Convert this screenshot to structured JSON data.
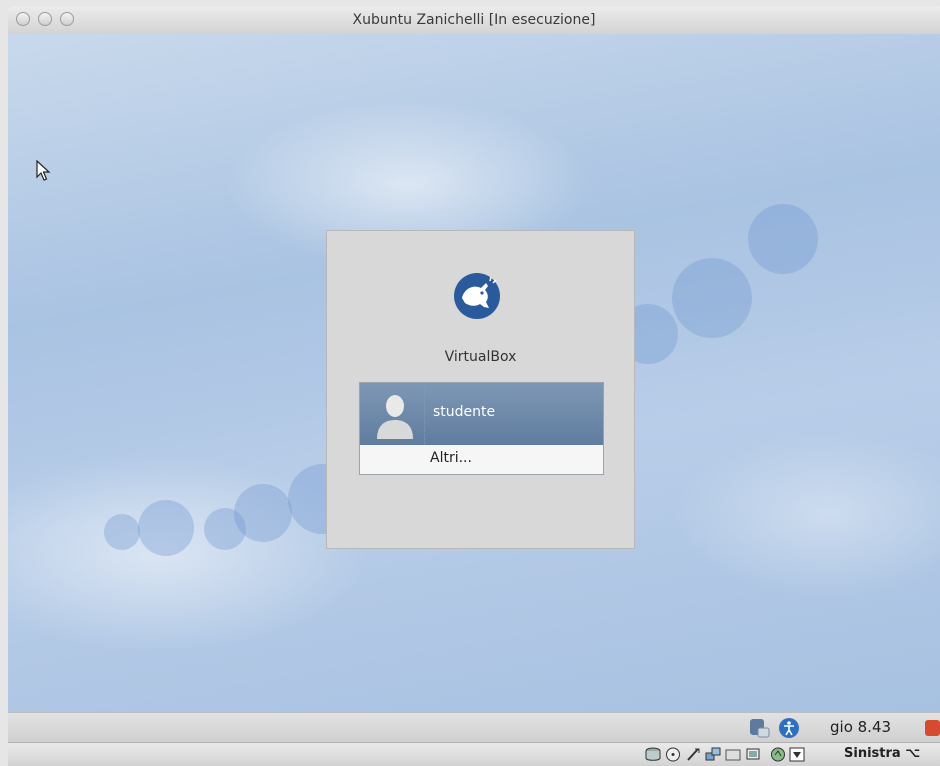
{
  "window": {
    "title": "Xubuntu Zanichelli [In esecuzione]"
  },
  "login": {
    "hostname": "VirtualBox",
    "users": [
      {
        "name": "studente"
      }
    ],
    "other": "Altri..."
  },
  "panel": {
    "clock": "gio 8.43"
  },
  "statusbar": {
    "host_key": "Sinistra ⌥",
    "icons": [
      "hard-disk-icon",
      "optical-drive-icon",
      "usb-icon",
      "network-icon",
      "shared-folders-icon",
      "display-icon",
      "capture-icon",
      "arrow-down-icon"
    ]
  },
  "colors": {
    "selected_user": "#6e89ab",
    "desktop": "#b0c8e5",
    "panel_bg": "#d8d8d8"
  }
}
